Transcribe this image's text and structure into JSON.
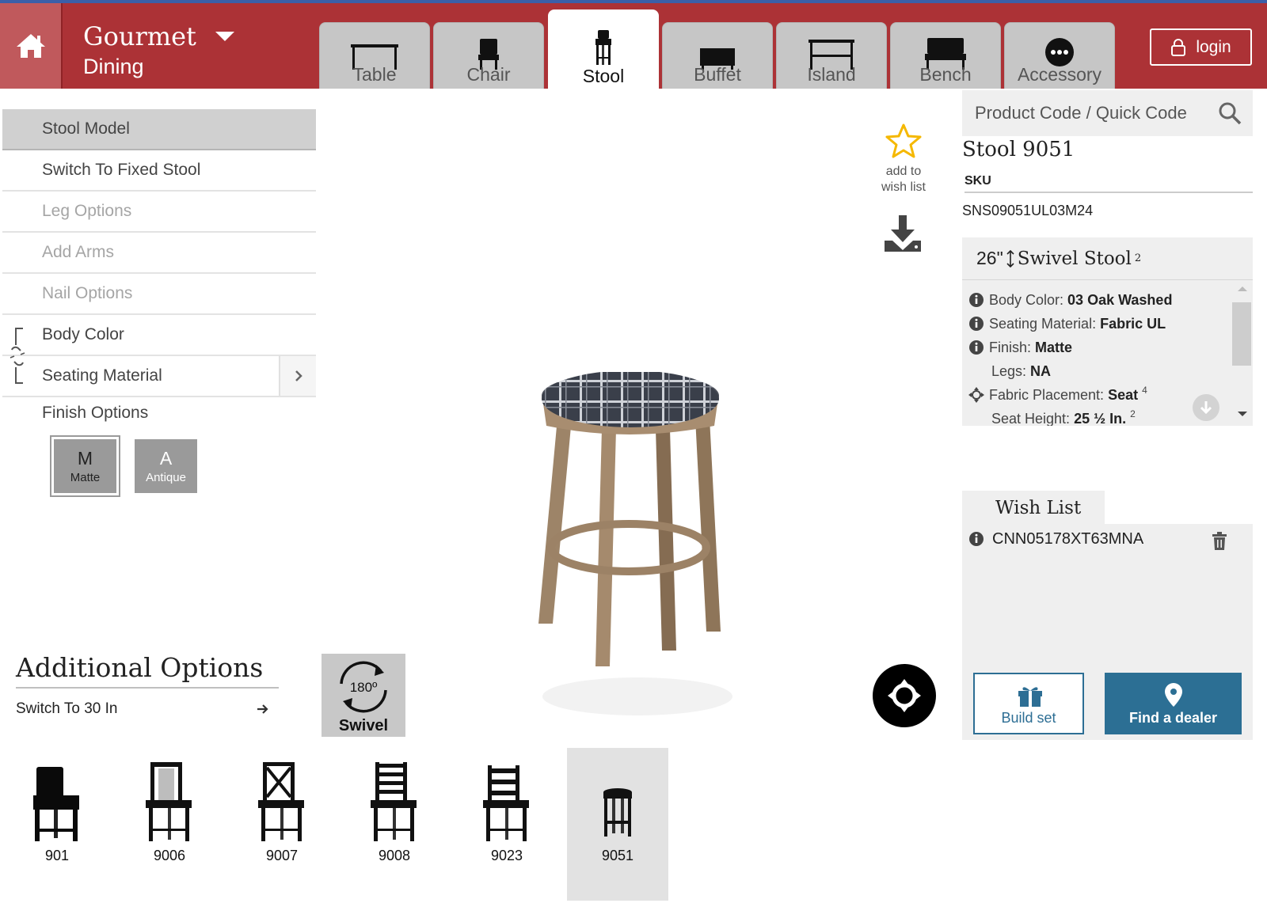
{
  "header": {
    "brand_name": "Gourmet",
    "brand_sub": "Dining",
    "login_label": "login",
    "tabs": [
      {
        "label": "Table",
        "icon": "table-icon"
      },
      {
        "label": "Chair",
        "icon": "chair-icon"
      },
      {
        "label": "Stool",
        "icon": "stool-icon",
        "active": true
      },
      {
        "label": "Buffet",
        "icon": "buffet-icon"
      },
      {
        "label": "Island",
        "icon": "island-icon"
      },
      {
        "label": "Bench",
        "icon": "bench-icon"
      },
      {
        "label": "Accessory",
        "icon": "ellipsis-icon"
      }
    ]
  },
  "left_menu": {
    "items": [
      {
        "label": "Stool Model"
      },
      {
        "label": "Switch To Fixed Stool"
      },
      {
        "label": "Leg Options"
      },
      {
        "label": "Add Arms"
      },
      {
        "label": "Nail Options"
      },
      {
        "label": "Body Color"
      },
      {
        "label": "Seating Material"
      }
    ],
    "finish_title": "Finish Options",
    "finish_options": [
      {
        "letter": "M",
        "label": "Matte",
        "selected": true
      },
      {
        "letter": "A",
        "label": "Antique",
        "selected": false
      }
    ]
  },
  "additional": {
    "title": "Additional Options",
    "switch_label": "Switch To 30 In",
    "swivel_degrees": "180º",
    "swivel_label": "Swivel"
  },
  "models": [
    {
      "code": "901"
    },
    {
      "code": "9006"
    },
    {
      "code": "9007"
    },
    {
      "code": "9008"
    },
    {
      "code": "9023"
    },
    {
      "code": "9051",
      "selected": true
    }
  ],
  "center": {
    "wish_add_label": "add to wish list"
  },
  "product": {
    "search_placeholder": "Product Code / Quick Code",
    "title": "Stool 9051",
    "sku_label": "SKU",
    "sku_value": "SNS09051UL03M24",
    "config_size": "26\"",
    "config_name": "Swivel Stool",
    "config_sup": "2",
    "specs": {
      "body_color_label": "Body Color:",
      "body_color_value": "03 Oak Washed",
      "seating_label": "Seating Material:",
      "seating_value": "Fabric UL",
      "finish_label": "Finish:",
      "finish_value": "Matte",
      "legs_label": "Legs:",
      "legs_value": "NA",
      "fabric_label": "Fabric Placement:",
      "fabric_value": "Seat",
      "fabric_sup": "4",
      "seat_height_label": "Seat Height:",
      "seat_height_value": "25 ½ In.",
      "seat_height_sup": "2"
    }
  },
  "wishlist": {
    "tab_label": "Wish List",
    "items": [
      {
        "code": "CNN05178XT63MNA"
      }
    ],
    "build_label": "Build set",
    "dealer_label": "Find a dealer"
  },
  "colors": {
    "header_red": "#ac3236",
    "primary_blue": "#2c6f94",
    "star_gold": "#f5b800"
  }
}
